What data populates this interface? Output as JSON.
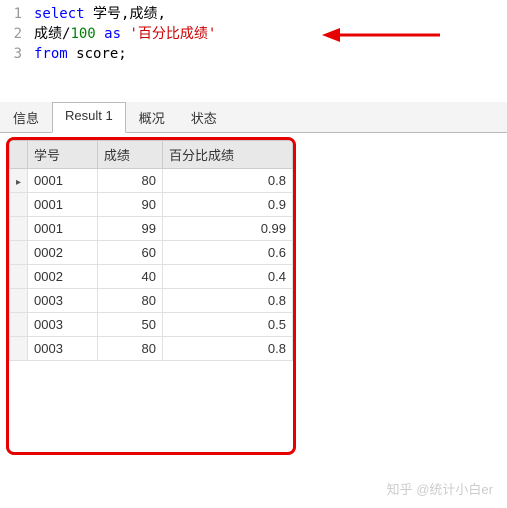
{
  "code": {
    "lines": [
      {
        "n": "1",
        "html": "<span class='kw'>select</span> <span class='ident'>学号,成绩,</span>"
      },
      {
        "n": "2",
        "html": "<span class='ident'>成绩/</span><span class='num'>100</span> <span class='kw'>as</span> <span class='str'>'百分比成绩'</span>"
      },
      {
        "n": "3",
        "html": "<span class='kw'>from</span> <span class='ident'>score;</span>"
      }
    ]
  },
  "tabs": {
    "info": "信息",
    "result": "Result 1",
    "overview": "概况",
    "status": "状态"
  },
  "table": {
    "headers": {
      "c1": "学号",
      "c2": "成绩",
      "c3": "百分比成绩"
    },
    "rows": [
      {
        "c1": "0001",
        "c2": "80",
        "c3": "0.8"
      },
      {
        "c1": "0001",
        "c2": "90",
        "c3": "0.9"
      },
      {
        "c1": "0001",
        "c2": "99",
        "c3": "0.99"
      },
      {
        "c1": "0002",
        "c2": "60",
        "c3": "0.6"
      },
      {
        "c1": "0002",
        "c2": "40",
        "c3": "0.4"
      },
      {
        "c1": "0003",
        "c2": "80",
        "c3": "0.8"
      },
      {
        "c1": "0003",
        "c2": "50",
        "c3": "0.5"
      },
      {
        "c1": "0003",
        "c2": "80",
        "c3": "0.8"
      }
    ]
  },
  "watermark": "知乎 @统计小白er"
}
